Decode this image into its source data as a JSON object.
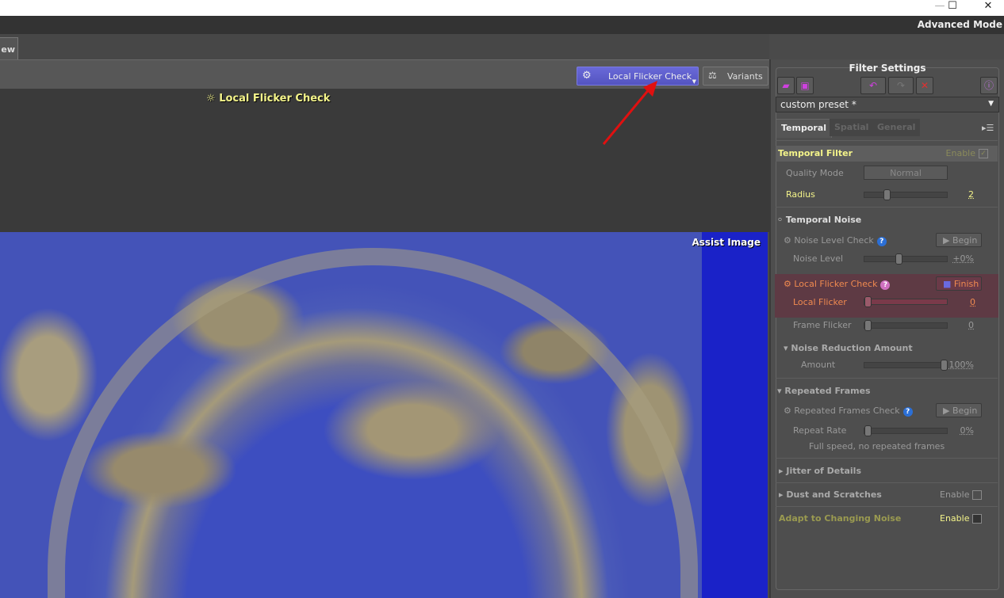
{
  "window": {
    "minimize": "—",
    "maximize": "☐",
    "close": "✕"
  },
  "mode_label": "Advanced Mode",
  "tab": {
    "label": "ew"
  },
  "toolbar": {
    "check_button": "Local Flicker Check",
    "variants_button": "Variants"
  },
  "overlay": {
    "title": "Local Flicker Check",
    "assist_label": "Assist Image"
  },
  "panel": {
    "title": "Filter Settings",
    "preset": "custom preset *",
    "tabs": [
      "Temporal",
      "Spatial",
      "General"
    ],
    "temporal_filter": {
      "title": "Temporal Filter",
      "enable": "Enable",
      "enabled": true,
      "quality_mode_label": "Quality Mode",
      "quality_mode": "Normal",
      "radius_label": "Radius",
      "radius": "2"
    },
    "temporal_noise": {
      "title": "Temporal Noise",
      "noise_check": "Noise Level Check",
      "begin": "Begin",
      "noise_level_label": "Noise Level",
      "noise_level": "+0%",
      "flicker_check": "Local Flicker Check",
      "finish": "Finish",
      "local_flicker_label": "Local Flicker",
      "local_flicker": "0",
      "frame_flicker_label": "Frame Flicker",
      "frame_flicker": "0",
      "nra_title": "Noise Reduction Amount",
      "amount_label": "Amount",
      "amount": "100%"
    },
    "repeated": {
      "title": "Repeated Frames",
      "check": "Repeated Frames Check",
      "begin": "Begin",
      "rate_label": "Repeat Rate",
      "rate": "0%",
      "note": "Full speed, no repeated frames"
    },
    "jitter": "Jitter of Details",
    "dust": {
      "title": "Dust and Scratches",
      "enable": "Enable"
    },
    "adapt": {
      "title": "Adapt to Changing Noise",
      "enable": "Enable"
    }
  },
  "colors": {
    "accent": "#5a5ac8",
    "highlight_row": "#5e3a44",
    "yellow": "#f4f48a"
  }
}
